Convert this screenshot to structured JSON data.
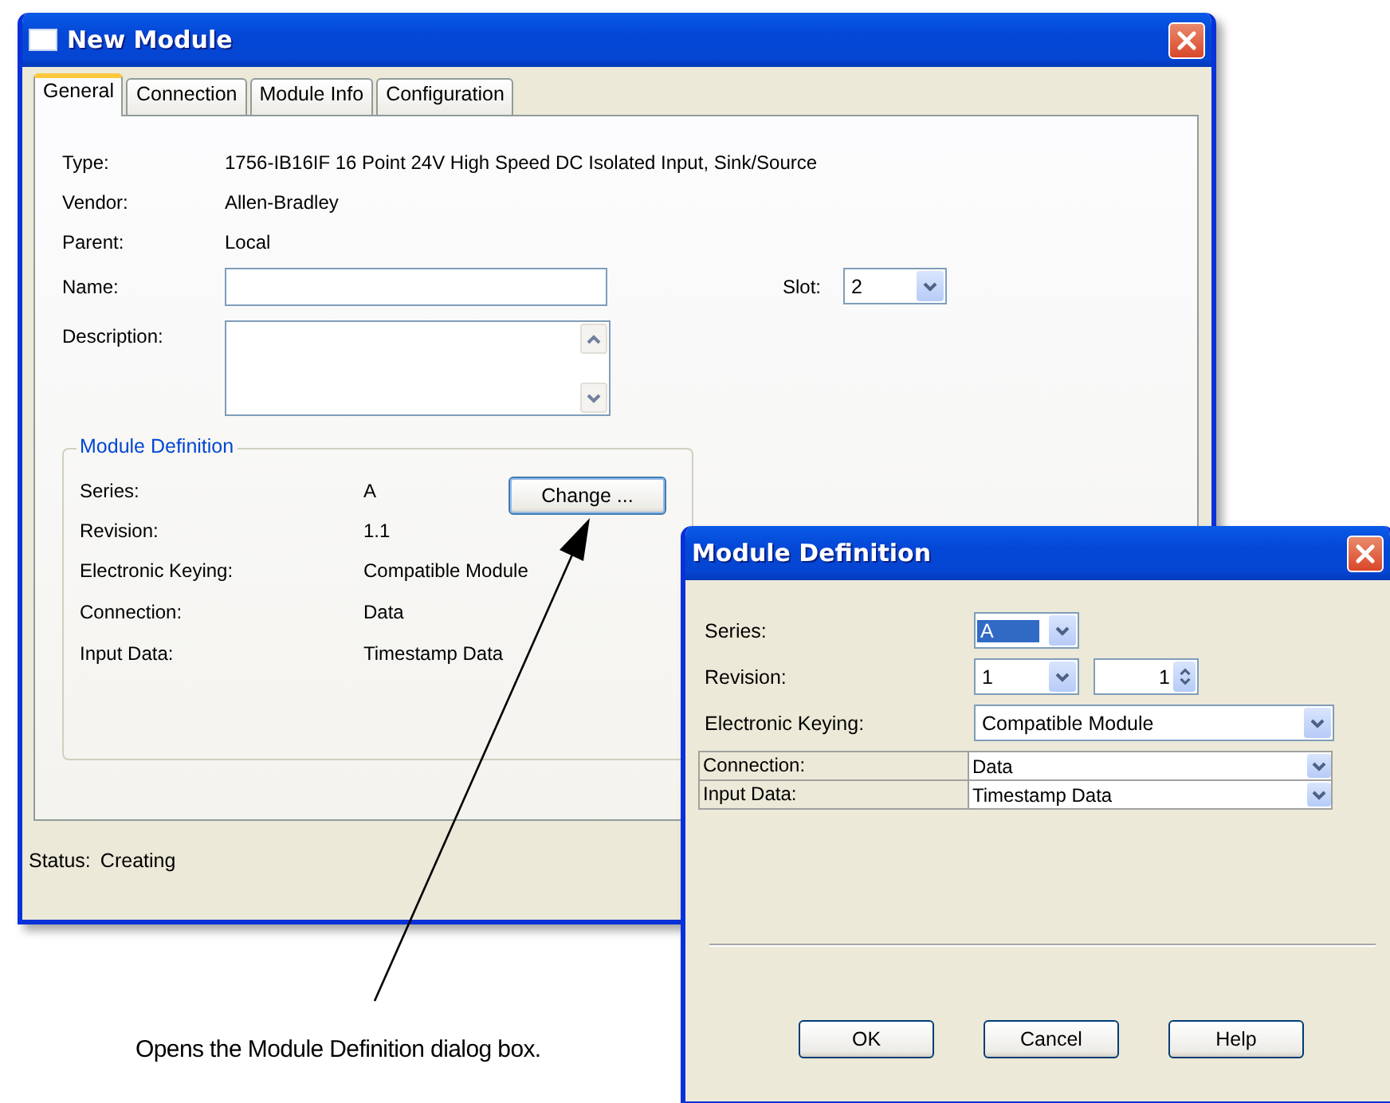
{
  "main_window": {
    "title": "New Module",
    "tabs": [
      {
        "label": "General",
        "selected": true
      },
      {
        "label": "Connection",
        "selected": false
      },
      {
        "label": "Module Info",
        "selected": false
      },
      {
        "label": "Configuration",
        "selected": false
      }
    ],
    "info": [
      {
        "label": "Type:",
        "value": "1756-IB16IF 16 Point 24V High Speed DC Isolated Input, Sink/Source"
      },
      {
        "label": "Vendor:",
        "value": "Allen-Bradley"
      },
      {
        "label": "Parent:",
        "value": "Local"
      }
    ],
    "name": {
      "label": "Name:"
    },
    "slot": {
      "label": "Slot:",
      "value": "2"
    },
    "description": {
      "label": "Description:"
    },
    "module_definition": {
      "title": "Module Definition",
      "change_button": "Change ...",
      "rows": [
        {
          "label": "Series:",
          "value": "A"
        },
        {
          "label": "Revision:",
          "value": "1.1"
        },
        {
          "label": "Electronic Keying:",
          "value": "Compatible Module"
        },
        {
          "label": "Connection:",
          "value": "Data"
        },
        {
          "label": "Input Data:",
          "value": "Timestamp Data"
        }
      ]
    },
    "status": {
      "label": "Status:",
      "value": "Creating"
    }
  },
  "dialog": {
    "title": "Module Definition",
    "series": {
      "label": "Series:",
      "value": "A"
    },
    "revision": {
      "label": "Revision:",
      "major": "1",
      "minor": "1"
    },
    "keying": {
      "label": "Electronic Keying:",
      "value": "Compatible Module"
    },
    "grid_rows": [
      {
        "label": "Connection:",
        "value": "Data"
      },
      {
        "label": "Input Data:",
        "value": "Timestamp Data"
      }
    ],
    "buttons": [
      "OK",
      "Cancel",
      "Help"
    ]
  },
  "callout": {
    "text": "Opens the Module Definition dialog box."
  }
}
